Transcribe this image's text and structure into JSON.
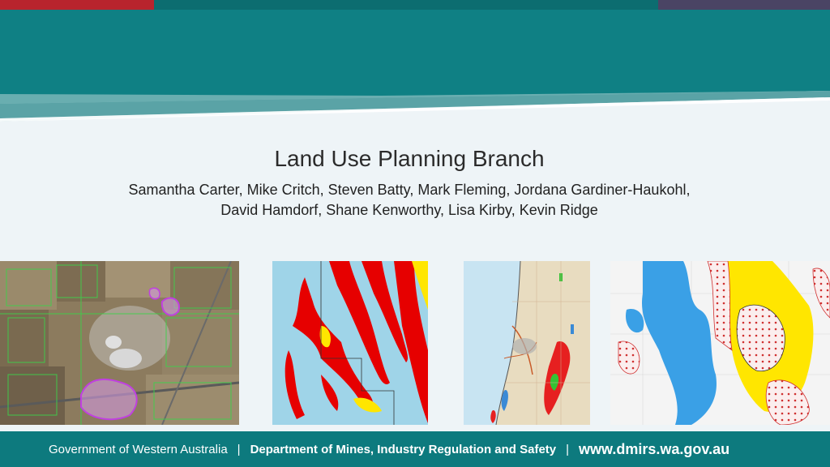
{
  "slide": {
    "title": "Land Use Planning Branch",
    "authors_line1": "Samantha Carter, Mike Critch, Steven Batty, Mark Fleming, Jordana Gardiner-Haukohl,",
    "authors_line2": "David Hamdorf, Shane Kenworthy, Lisa Kirby, Kevin Ridge"
  },
  "images": [
    {
      "name": "aerial-land-parcels-map",
      "description_color": "#8c7b5e"
    },
    {
      "name": "red-yellow-zone-map",
      "description_color": "#e60000"
    },
    {
      "name": "coastal-topographic-map",
      "description_color": "#e8dcc0"
    },
    {
      "name": "blue-yellow-dotted-zone-map",
      "description_color": "#3aa0e6"
    }
  ],
  "colors": {
    "header_teal": "#0f8084",
    "footer_teal": "#0d7a7e",
    "strip_red": "#b8242d",
    "strip_purple": "#4a4464"
  },
  "footer": {
    "government": "Government of Western Australia",
    "separator": "|",
    "department": "Department of Mines, Industry Regulation and Safety",
    "website": "www.dmirs.wa.gov.au"
  }
}
